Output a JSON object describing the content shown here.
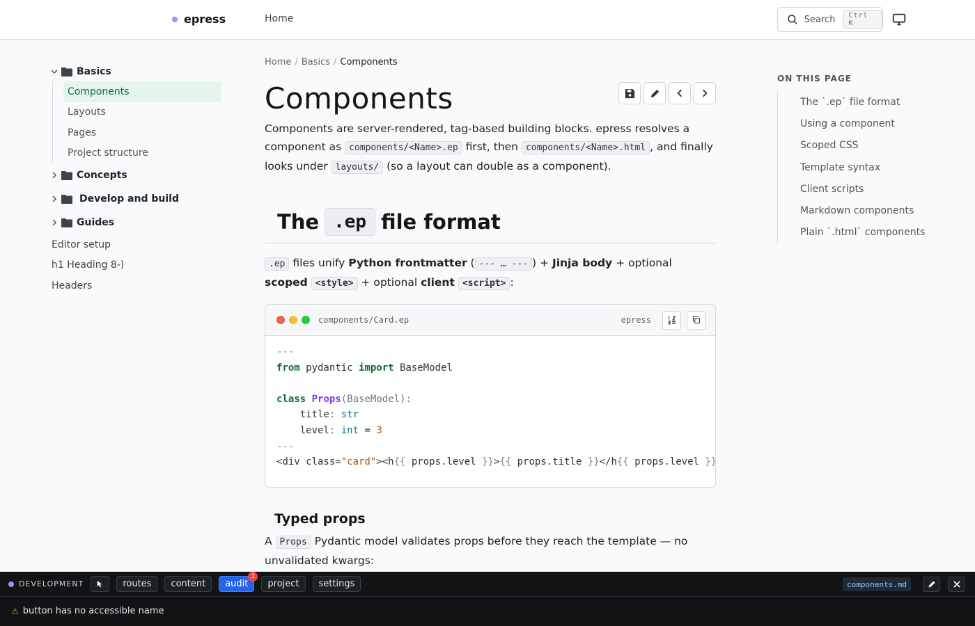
{
  "header": {
    "brand": "epress",
    "nav_home": "Home",
    "search_label": "Search",
    "search_kbd": "Ctrl K"
  },
  "sidebar": {
    "groups": [
      {
        "label": "Basics",
        "expanded": true,
        "children": [
          "Components",
          "Layouts",
          "Pages",
          "Project structure"
        ],
        "active": "Components"
      },
      {
        "label": "Concepts",
        "expanded": false
      },
      {
        "label": "Develop and build",
        "expanded": false
      },
      {
        "label": "Guides",
        "expanded": false
      }
    ],
    "links": [
      "Editor setup",
      "h1 Heading 8-)",
      "Headers"
    ]
  },
  "main": {
    "breadcrumb": [
      "Home",
      "Basics",
      "Components"
    ],
    "title": "Components",
    "intro": {
      "p1": "Components are server-rendered, tag-based building blocks. epress resolves a component as ",
      "code1": "components/<Name>.ep",
      "p2": " first, then ",
      "code2": "components/<Name>.html",
      "p3": ", and finally looks under ",
      "code3": "layouts/",
      "p4": " (so a layout can double as a component)."
    },
    "section1": {
      "heading_pre": "The",
      "heading_code": ".ep",
      "heading_post": "file format",
      "para": {
        "code1": ".ep",
        "t1": " files unify ",
        "b1": "Python frontmatter",
        "t2": " (",
        "code2": "--- … ---",
        "t3": ") + ",
        "b2": "Jinja body",
        "t4": " + optional ",
        "b3": "scoped",
        "code3": "<style>",
        "t5": " + optional ",
        "b4": "client",
        "code4": "<script>",
        "t6": ":"
      }
    },
    "codeblock": {
      "filename": "components/Card.ep",
      "language": "epress",
      "lines": {
        "l1": "---",
        "l2_kw1": "from",
        "l2_mod": " pydantic ",
        "l2_kw2": "import",
        "l2_name": " BaseModel",
        "l4_kw": "class",
        "l4_cls": "Props",
        "l4_rest": "(BaseModel):",
        "l5_name": "    title",
        "l5_colon": ": ",
        "l5_type": "str",
        "l6_name": "    level",
        "l6_colon": ": ",
        "l6_type": "int",
        "l6_eq": " = ",
        "l6_num": "3",
        "l7": "---",
        "l8_a": "<div class=",
        "l8_str": "\"card\"",
        "l8_b": "><h",
        "l8_c": "{{",
        "l8_d": " props.level ",
        "l8_e": "}}",
        "l8_f": ">",
        "l8_g": "{{",
        "l8_h": " props.title ",
        "l8_i": "}}",
        "l8_j": "</h",
        "l8_k": "{{",
        "l8_l": " props.level ",
        "l8_m": "}}"
      }
    },
    "section2": {
      "heading": "Typed props",
      "t1": "A ",
      "code1": "Props",
      "t2": " Pydantic model validates props before they reach the template — no unvalidated kwargs:"
    }
  },
  "toc": {
    "title": "ON THIS PAGE",
    "items": [
      "The `.ep` file format",
      "Using a component",
      "Scoped CSS",
      "Template syntax",
      "Client scripts",
      "Markdown components",
      "Plain `.html` components"
    ]
  },
  "devbar": {
    "label": "DEVELOPMENT",
    "tabs": [
      "routes",
      "content",
      "audit",
      "project",
      "settings"
    ],
    "active_tab": "audit",
    "audit_badge": "1",
    "file": "components.md",
    "message": "button has no accessible name"
  },
  "colors": {
    "accent": "#a78bfa",
    "active_bg": "#e6f5ec",
    "active_text": "#0f6b3a",
    "devbar_bg": "#111315",
    "devbar_active": "#2563eb"
  }
}
